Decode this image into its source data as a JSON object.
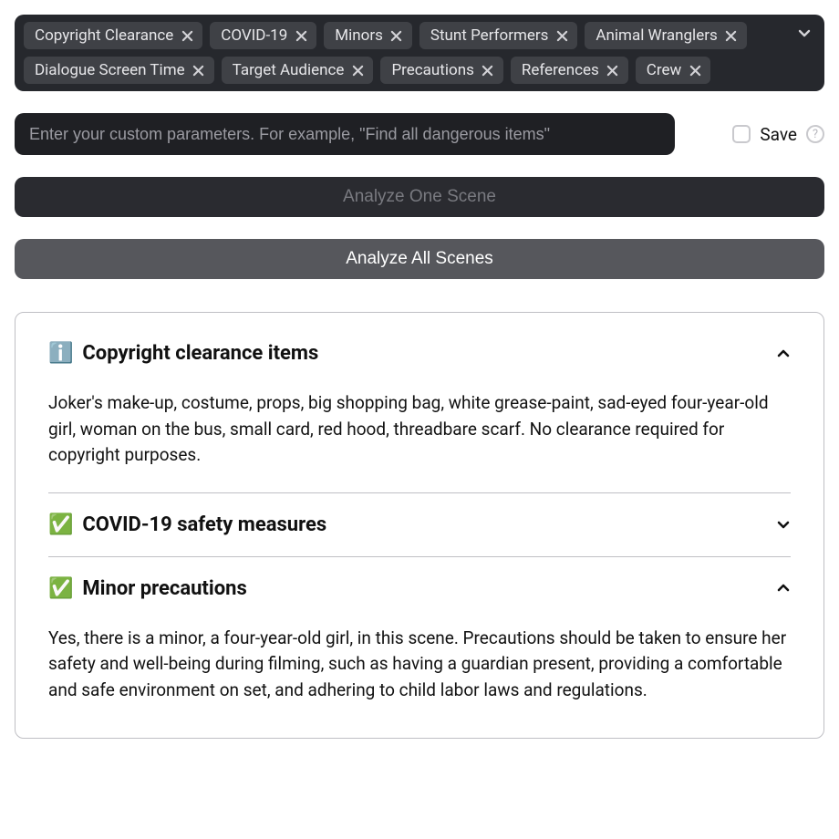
{
  "tags": [
    "Copyright Clearance",
    "COVID-19",
    "Minors",
    "Stunt Performers",
    "Animal Wranglers",
    "Dialogue Screen Time",
    "Target Audience",
    "Precautions",
    "References",
    "Crew"
  ],
  "input": {
    "placeholder": "Enter your custom parameters. For example, \"Find all dangerous items\""
  },
  "save": {
    "label": "Save",
    "help": "?"
  },
  "buttons": {
    "analyze_one": "Analyze One Scene",
    "analyze_all": "Analyze All Scenes"
  },
  "results": [
    {
      "status": "ℹ️",
      "title": "Copyright clearance items",
      "expanded": true,
      "body": "Joker's make-up, costume, props, big shopping bag, white grease-paint, sad-eyed four-year-old girl, woman on the bus, small card, red hood, threadbare scarf. No clearance required for copyright purposes."
    },
    {
      "status": "✅",
      "title": "COVID-19 safety measures",
      "expanded": false,
      "body": ""
    },
    {
      "status": "✅",
      "title": "Minor precautions",
      "expanded": true,
      "body": "Yes, there is a minor, a four-year-old girl, in this scene. Precautions should be taken to ensure her safety and well-being during filming, such as having a guardian present, providing a comfortable and safe environment on set, and adhering to child labor laws and regulations."
    }
  ]
}
